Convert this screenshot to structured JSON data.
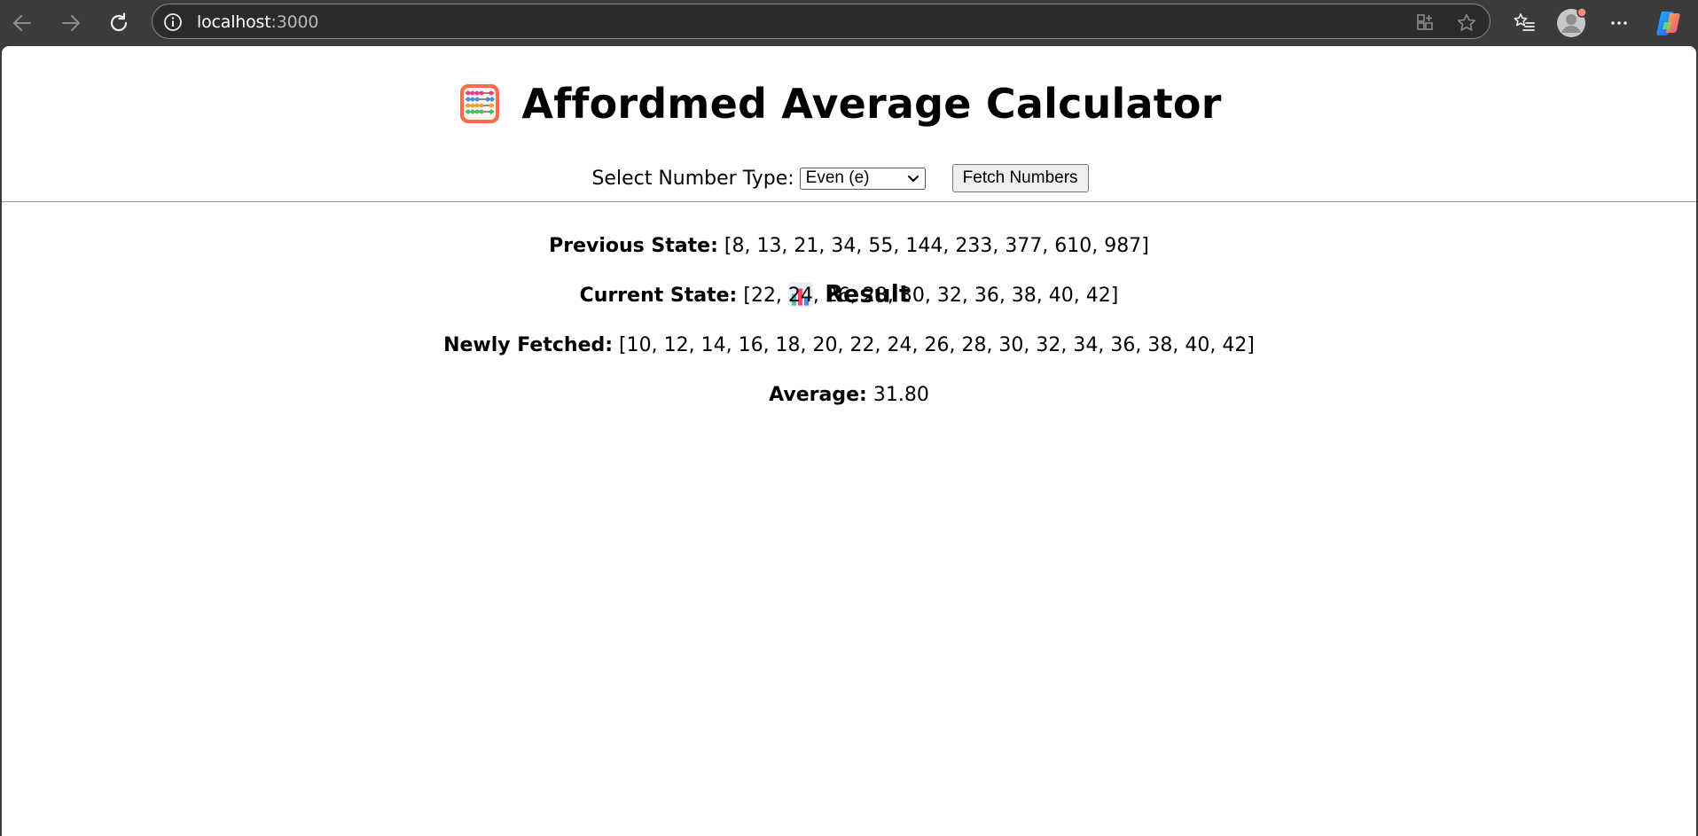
{
  "browser": {
    "url_host": "localhost",
    "url_port": ":3000"
  },
  "page": {
    "title": "Affordmed Average Calculator",
    "select_label": "Select Number Type:",
    "select_value": "Even (e)",
    "fetch_button": "Fetch Numbers"
  },
  "result": {
    "heading": "Result",
    "previous_label": "Previous State:",
    "previous_value": "[8, 13, 21, 34, 55, 144, 233, 377, 610, 987]",
    "current_label": "Current State:",
    "current_value": "[22, 24, 26, 28, 30, 32, 36, 38, 40, 42]",
    "newly_label": "Newly Fetched:",
    "newly_value": "[10, 12, 14, 16, 18, 20, 22, 24, 26, 28, 30, 32, 34, 36, 38, 40, 42]",
    "average_label": "Average:",
    "average_value": "31.80"
  },
  "icons": {
    "title_icon": "abacus-icon",
    "result_icon": "bar-chart-icon"
  }
}
